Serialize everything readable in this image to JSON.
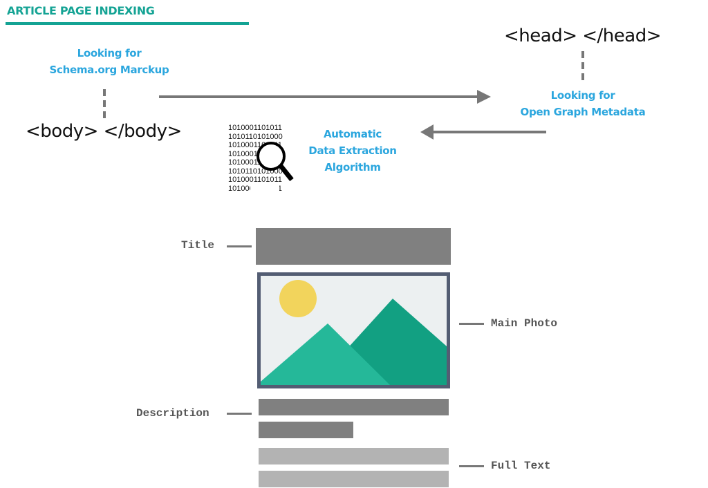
{
  "heading": "ARTICLE PAGE INDEXING",
  "schema_label": [
    "Looking for",
    "Schema.org Marckup"
  ],
  "opengraph_label": [
    "Looking for",
    "Open Graph Metadata"
  ],
  "algorithm_label": [
    "Automatic",
    "Data Extraction",
    "Algorithm"
  ],
  "body_tag": "<body>  </body>",
  "head_tag": "<head>  </head>",
  "binary_lines": [
    "1010001101011",
    "1010110101000",
    "1010001101011",
    "1010001101011",
    "1010001101011",
    "1010110101000",
    "1010001101011",
    "1010001101011"
  ],
  "labels": {
    "title": "Title",
    "main_photo": "Main Photo",
    "description": "Description",
    "full_text": "Full Text"
  },
  "colors": {
    "accent_teal": "#14a394",
    "label_blue": "#2ba6de",
    "arrow_gray": "#777777",
    "frame": "#535d73",
    "sky": "#ecf0f1",
    "sun": "#f2d45c",
    "mountain_front": "#25b899",
    "mountain_back": "#12a082"
  }
}
